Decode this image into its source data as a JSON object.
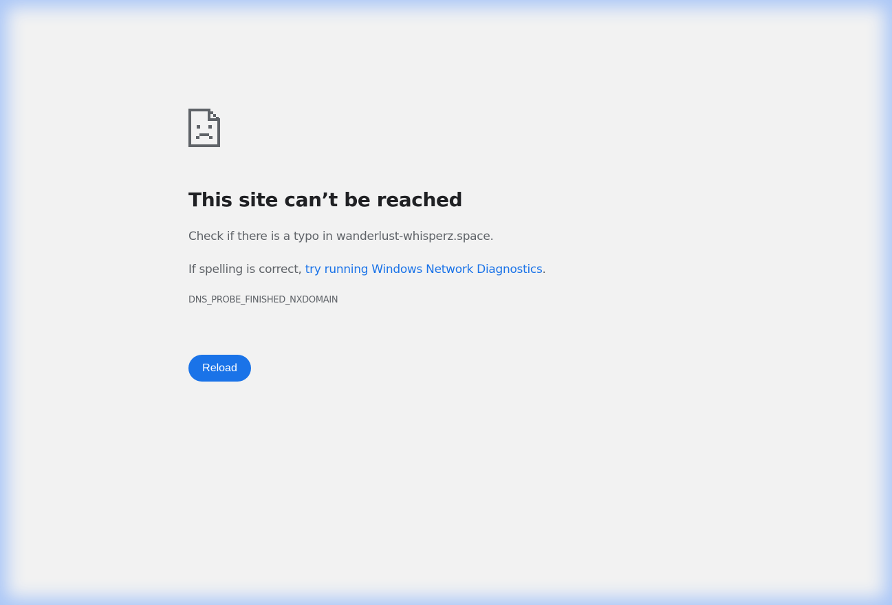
{
  "error_page": {
    "icon": "sad-page-icon",
    "title": "This site can’t be reached",
    "message_typo": "Check if there is a typo in wanderlust-whisperz.space.",
    "message_spelling_prefix": "If spelling is correct, ",
    "diagnostics_link": "try running Windows Network Diagnostics",
    "message_spelling_suffix": ".",
    "error_code": "DNS_PROBE_FINISHED_NXDOMAIN",
    "reload_label": "Reload"
  },
  "colors": {
    "background": "#f2f2f2",
    "title": "#202124",
    "body_text": "#5f6368",
    "link": "#1a73e8",
    "button": "#1a73e8",
    "frame_glow": "#a9c6f7"
  }
}
